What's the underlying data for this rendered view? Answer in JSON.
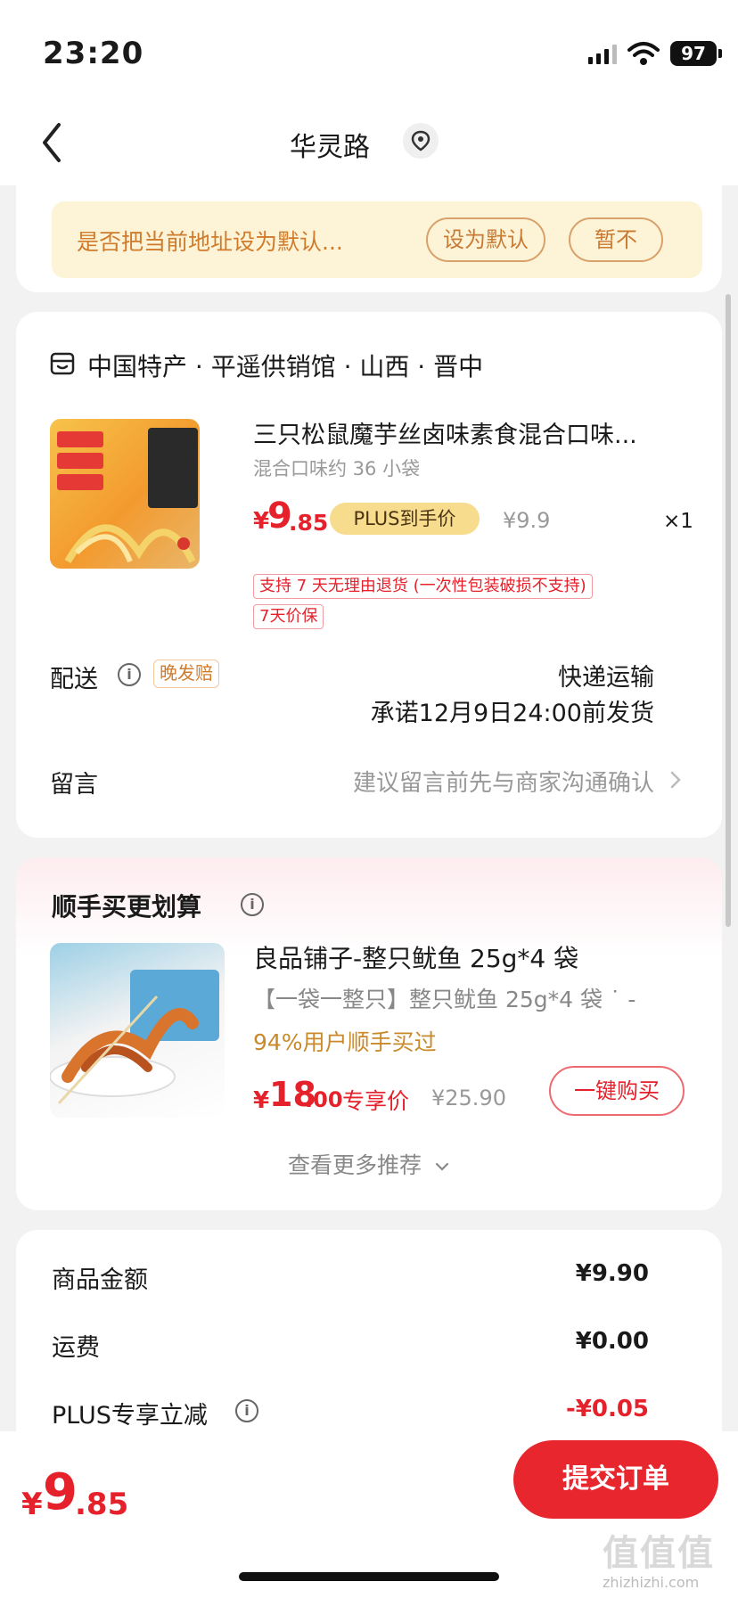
{
  "status_bar": {
    "time": "23:20",
    "battery": "97"
  },
  "nav": {
    "title": "华灵路"
  },
  "default_address": {
    "prompt": "是否把当前地址设为默认...",
    "set_default_label": "设为默认",
    "not_now_label": "暂不"
  },
  "order": {
    "store": "中国特产 · 平遥供销馆 · 山西 · 晋中",
    "product": {
      "title": "三只松鼠魔芋丝卤味素食混合口味...",
      "spec": "混合口味约 36 小袋",
      "price_symbol": "¥",
      "price_int": "9",
      "price_dec": ".85",
      "plus_tag": "PLUS到手价",
      "original_price": "¥9.9",
      "quantity": "×1",
      "return_policy": "支持 7 天无理由退货 (一次性包装破损不支持)",
      "price_protect": "7天价保"
    },
    "shipping": {
      "label": "配送",
      "late_tag": "晚发赔",
      "method": "快递运输",
      "promise": "承诺12月9日24:00前发货"
    },
    "memo": {
      "label": "留言",
      "hint": "建议留言前先与商家沟通确认"
    }
  },
  "recommend": {
    "title": "顺手买更划算",
    "item": {
      "name": "良品铺子-整只鱿鱼 25g*4 袋",
      "desc": "【一袋一整只】整只鱿鱼 25g*4 袋 ˙ -",
      "social": "94%用户顺手买过",
      "price_symbol": "¥",
      "price_int": "18",
      "price_dec": ".00",
      "price_label": "专享价",
      "original_price": "¥25.90",
      "buy_label": "一键购买"
    },
    "more_label": "查看更多推荐"
  },
  "summary": {
    "rows": [
      {
        "label": "商品金额",
        "value": "¥9.90"
      },
      {
        "label": "运费",
        "value": "¥0.00"
      },
      {
        "label": "PLUS专享立减",
        "value": "-¥0.05"
      }
    ]
  },
  "bottom": {
    "total_symbol": "¥",
    "total_int": "9",
    "total_dec": ".85",
    "submit_label": "提交订单",
    "watermark": "值值值",
    "watermark_url": "zhizhizhi.com"
  },
  "colors": {
    "accent_red": "#e8262e",
    "warning_orange": "#d07b2c",
    "banner_bg": "#fdf4d7",
    "plus_gold": "#f6dc8c"
  },
  "icons": [
    "back-chevron-icon",
    "location-icon",
    "store-icon",
    "info-icon",
    "chevron-right-icon",
    "chevron-down-icon",
    "signal-icon",
    "wifi-icon",
    "battery-icon"
  ]
}
